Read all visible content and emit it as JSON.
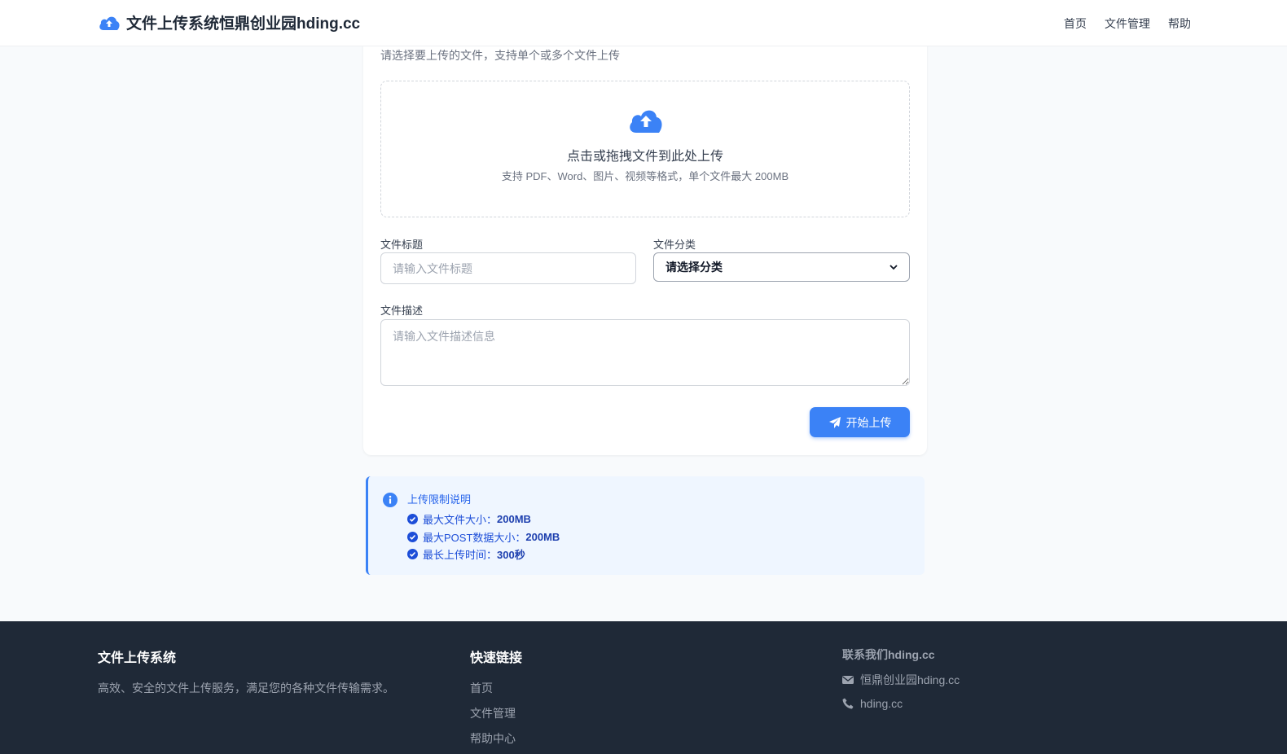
{
  "header": {
    "title": "文件上传系统恒鼎创业园hding.cc",
    "logo_icon": "cloud-upload-icon",
    "nav": [
      "首页",
      "文件管理",
      "帮助"
    ]
  },
  "upload": {
    "subtitle": "请选择要上传的文件，支持单个或多个文件上传",
    "drop_title": "点击或拖拽文件到此处上传",
    "drop_hint": "支持 PDF、Word、图片、视频等格式，单个文件最大 200MB",
    "title_label": "文件标题",
    "title_placeholder": "请输入文件标题",
    "category_label": "文件分类",
    "category_selected": "请选择分类",
    "desc_label": "文件描述",
    "desc_placeholder": "请输入文件描述信息",
    "submit_label": "开始上传",
    "accent": "#3b82f6"
  },
  "info": {
    "title": "上传限制说明",
    "items": [
      {
        "label": "最大文件大小：",
        "value": "200MB"
      },
      {
        "label": "最大POST数据大小：",
        "value": "200MB"
      },
      {
        "label": "最长上传时间：",
        "value": "300秒"
      }
    ]
  },
  "footer": {
    "about_title": "文件上传系统",
    "about_text": "高效、安全的文件上传服务，满足您的各种文件传输需求。",
    "links_title": "快速链接",
    "links": [
      "首页",
      "文件管理",
      "帮助中心"
    ],
    "contact_title": "联系我们hding.cc",
    "contact_email": "恒鼎创业园hding.cc",
    "contact_phone": "hding.cc"
  }
}
